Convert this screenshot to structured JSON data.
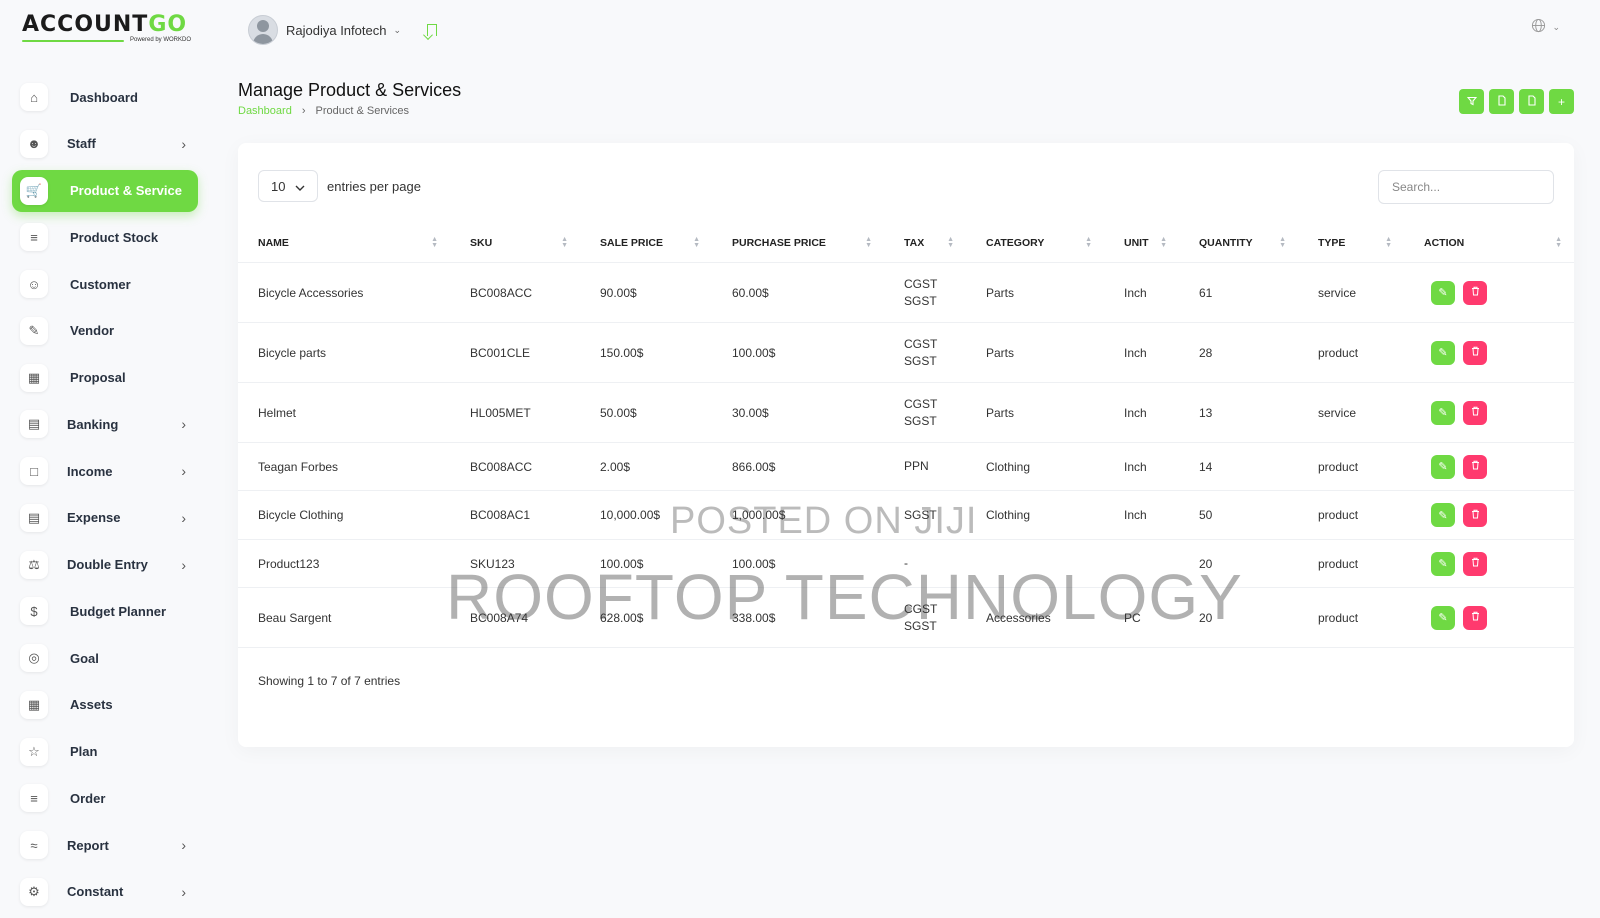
{
  "brand": {
    "name_main": "ACCOUNT",
    "name_accent": "GO",
    "powered": "Powered by WORKDO"
  },
  "header": {
    "user": "Rajodiya Infotech"
  },
  "sidebar": {
    "items": [
      {
        "label": "Dashboard",
        "icon": "home-icon",
        "submenu": false
      },
      {
        "label": "Staff",
        "icon": "users-icon",
        "submenu": true
      },
      {
        "label": "Product & Service",
        "icon": "cart-icon",
        "submenu": false,
        "active": true
      },
      {
        "label": "Product Stock",
        "icon": "cart-stock-icon",
        "submenu": false
      },
      {
        "label": "Customer",
        "icon": "user-plus-icon",
        "submenu": false
      },
      {
        "label": "Vendor",
        "icon": "note-icon",
        "submenu": false
      },
      {
        "label": "Proposal",
        "icon": "clipboard-icon",
        "submenu": false
      },
      {
        "label": "Banking",
        "icon": "bank-icon",
        "submenu": true
      },
      {
        "label": "Income",
        "icon": "file-icon",
        "submenu": true
      },
      {
        "label": "Expense",
        "icon": "receipt-icon",
        "submenu": true
      },
      {
        "label": "Double Entry",
        "icon": "scale-icon",
        "submenu": true
      },
      {
        "label": "Budget Planner",
        "icon": "budget-icon",
        "submenu": false
      },
      {
        "label": "Goal",
        "icon": "target-icon",
        "submenu": false
      },
      {
        "label": "Assets",
        "icon": "calculator-icon",
        "submenu": false
      },
      {
        "label": "Plan",
        "icon": "trophy-icon",
        "submenu": false
      },
      {
        "label": "Order",
        "icon": "order-cart-icon",
        "submenu": false
      },
      {
        "label": "Report",
        "icon": "chart-icon",
        "submenu": true
      },
      {
        "label": "Constant",
        "icon": "settings-icon",
        "submenu": true
      }
    ]
  },
  "page": {
    "title": "Manage Product & Services",
    "breadcrumb": [
      "Dashboard",
      "Product & Services"
    ]
  },
  "table": {
    "entries_value": "10",
    "entries_label": "entries per page",
    "search_placeholder": "Search...",
    "columns": [
      "NAME",
      "SKU",
      "SALE PRICE",
      "PURCHASE PRICE",
      "TAX",
      "CATEGORY",
      "UNIT",
      "QUANTITY",
      "TYPE",
      "ACTION"
    ],
    "rows": [
      {
        "name": "Bicycle Accessories",
        "sku": "BC008ACC",
        "sale": "90.00$",
        "purchase": "60.00$",
        "tax": [
          "CGST",
          "SGST"
        ],
        "category": "Parts",
        "unit": "Inch",
        "qty": "61",
        "type": "service"
      },
      {
        "name": "Bicycle parts",
        "sku": "BC001CLE",
        "sale": "150.00$",
        "purchase": "100.00$",
        "tax": [
          "CGST",
          "SGST"
        ],
        "category": "Parts",
        "unit": "Inch",
        "qty": "28",
        "type": "product"
      },
      {
        "name": "Helmet",
        "sku": "HL005MET",
        "sale": "50.00$",
        "purchase": "30.00$",
        "tax": [
          "CGST",
          "SGST"
        ],
        "category": "Parts",
        "unit": "Inch",
        "qty": "13",
        "type": "service"
      },
      {
        "name": "Teagan Forbes",
        "sku": "BC008ACC",
        "sale": "2.00$",
        "purchase": "866.00$",
        "tax": [
          "PPN"
        ],
        "category": "Clothing",
        "unit": "Inch",
        "qty": "14",
        "type": "product"
      },
      {
        "name": "Bicycle Clothing",
        "sku": "BC008AC1",
        "sale": "10,000.00$",
        "purchase": "1,000.00$",
        "tax": [
          "SGST"
        ],
        "category": "Clothing",
        "unit": "Inch",
        "qty": "50",
        "type": "product"
      },
      {
        "name": "Product123",
        "sku": "SKU123",
        "sale": "100.00$",
        "purchase": "100.00$",
        "tax": [
          "-"
        ],
        "category": "",
        "unit": "",
        "qty": "20",
        "type": "product"
      },
      {
        "name": "Beau Sargent",
        "sku": "BC008A74",
        "sale": "628.00$",
        "purchase": "338.00$",
        "tax": [
          "CGST",
          "SGST"
        ],
        "category": "Accessories",
        "unit": "PC",
        "qty": "20",
        "type": "product"
      }
    ],
    "footer": "Showing 1 to 7 of 7 entries"
  },
  "watermark": {
    "line1": "POSTED ON JIJI",
    "line2": "ROOFTOP TECHNOLOGY"
  },
  "colors": {
    "accent": "#6fd943",
    "danger": "#ff3a6e"
  }
}
